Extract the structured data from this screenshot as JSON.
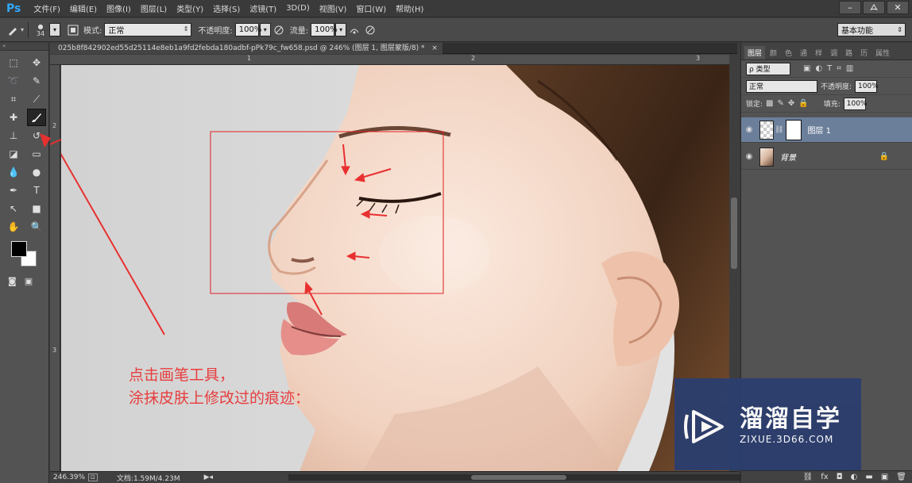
{
  "app": {
    "logo": "Ps"
  },
  "menu": [
    "文件(F)",
    "编辑(E)",
    "图像(I)",
    "图层(L)",
    "类型(Y)",
    "选择(S)",
    "滤镜(T)",
    "3D(D)",
    "视图(V)",
    "窗口(W)",
    "帮助(H)"
  ],
  "window_controls": {
    "minimize": "–",
    "restore": "ᗋ",
    "close": "✕"
  },
  "options": {
    "brush_size": "34",
    "mode_label": "模式:",
    "mode_value": "正常",
    "opacity_label": "不透明度:",
    "opacity_value": "100%",
    "flow_label": "流量:",
    "flow_value": "100%",
    "workspace": "基本功能"
  },
  "document": {
    "tab_title": "025b8f842902ed55d25114e8eb1a9fd2febda180adbf-pPk79c_fw658.psd @ 246% (图层 1, 图层蒙版/8) *",
    "tab_close": "×",
    "ruler_top": [
      "1",
      "2",
      "3"
    ],
    "ruler_left": [
      "2",
      "3"
    ]
  },
  "status": {
    "zoom": "246.39%",
    "doc_info": "文档:1.59M/4.23M"
  },
  "layers_panel": {
    "tabs": [
      "图层",
      "颜",
      "色",
      "通",
      "样",
      "调",
      "路",
      "历",
      "属性"
    ],
    "filter_kind": "ρ 类型",
    "blend_mode": "正常",
    "opacity_label": "不透明度:",
    "opacity_value": "100%",
    "lock_label": "锁定:",
    "fill_label": "填充:",
    "fill_value": "100%",
    "layers": [
      {
        "name": "图层 1",
        "selected": true
      },
      {
        "name": "背景",
        "selected": false
      }
    ],
    "footer_icons": [
      "link-icon",
      "fx-icon",
      "mask-icon",
      "adjustment-icon",
      "folder-icon",
      "new-layer-icon",
      "trash-icon"
    ]
  },
  "annotation": {
    "line1": "点击画笔工具，",
    "line2": "涂抹皮肤上修改过的痕迹：",
    "color": "#e83d3d"
  },
  "watermark": {
    "title": "溜溜自学",
    "url": "ZIXUE.3D66.COM"
  }
}
